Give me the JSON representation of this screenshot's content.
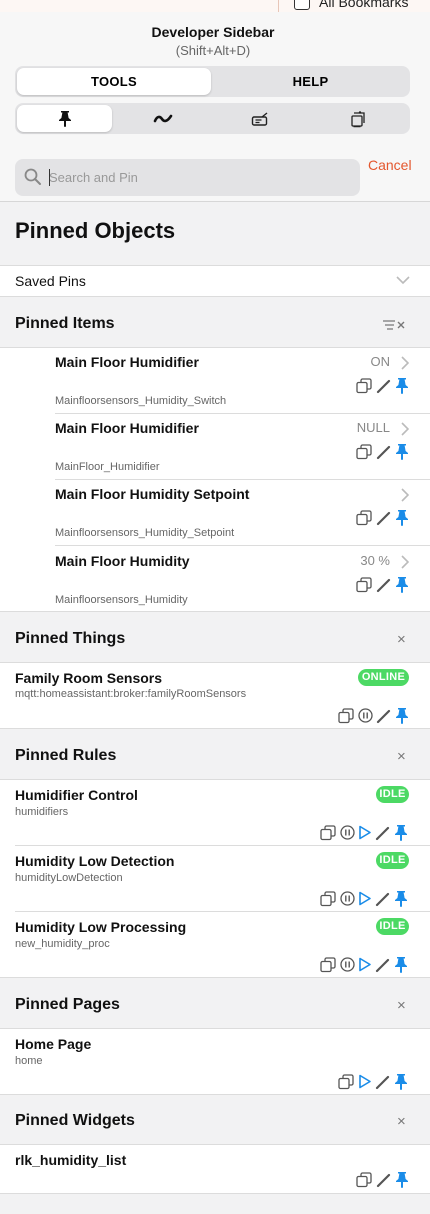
{
  "browser": {
    "bookmarks_label": "All Bookmarks"
  },
  "sidebar": {
    "title": "Developer Sidebar",
    "shortcut": "(Shift+Alt+D)"
  },
  "tabs": [
    {
      "label": "TOOLS",
      "selected": true
    },
    {
      "label": "HELP",
      "selected": false
    }
  ],
  "tool_tabs": [
    {
      "icon": "pin-icon",
      "selected": true
    },
    {
      "icon": "activity-icon",
      "selected": false
    },
    {
      "icon": "keyboard-icon",
      "selected": false
    },
    {
      "icon": "notes-icon",
      "selected": false
    }
  ],
  "search": {
    "placeholder": "Search and Pin",
    "value": "",
    "cancel_label": "Cancel"
  },
  "page_title": "Pinned Objects",
  "saved_pins": {
    "label": "Saved Pins"
  },
  "pinned_items": {
    "title": "Pinned Items",
    "items": [
      {
        "name": "Main Floor Humidifier",
        "sub": "Mainfloorsensors_Humidity_Switch",
        "state": "ON"
      },
      {
        "name": "Main Floor Humidifier",
        "sub": "MainFloor_Humidifier",
        "state": "NULL"
      },
      {
        "name": "Main Floor Humidity Setpoint",
        "sub": "Mainfloorsensors_Humidity_Setpoint",
        "state": ""
      },
      {
        "name": "Main Floor Humidity",
        "sub": "Mainfloorsensors_Humidity",
        "state": "30 %"
      }
    ]
  },
  "pinned_things": {
    "title": "Pinned Things",
    "close_icon": "×",
    "items": [
      {
        "name": "Family Room Sensors",
        "sub": "mqtt:homeassistant:broker:familyRoomSensors",
        "status": "ONLINE"
      }
    ]
  },
  "pinned_rules": {
    "title": "Pinned Rules",
    "close_icon": "×",
    "items": [
      {
        "name": "Humidifier Control",
        "sub": "humidifiers",
        "status": "IDLE"
      },
      {
        "name": "Humidity Low Detection",
        "sub": "humidityLowDetection",
        "status": "IDLE"
      },
      {
        "name": "Humidity Low Processing",
        "sub": "new_humidity_proc",
        "status": "IDLE"
      }
    ]
  },
  "pinned_pages": {
    "title": "Pinned Pages",
    "close_icon": "×",
    "items": [
      {
        "name": "Home Page",
        "sub": "home"
      }
    ]
  },
  "pinned_widgets": {
    "title": "Pinned Widgets",
    "close_icon": "×",
    "items": [
      {
        "name": "rlk_humidity_list"
      }
    ]
  },
  "colors": {
    "accent_blue": "#1a8ce8",
    "cancel_orange": "#e4572e",
    "status_green": "#4cd964"
  }
}
